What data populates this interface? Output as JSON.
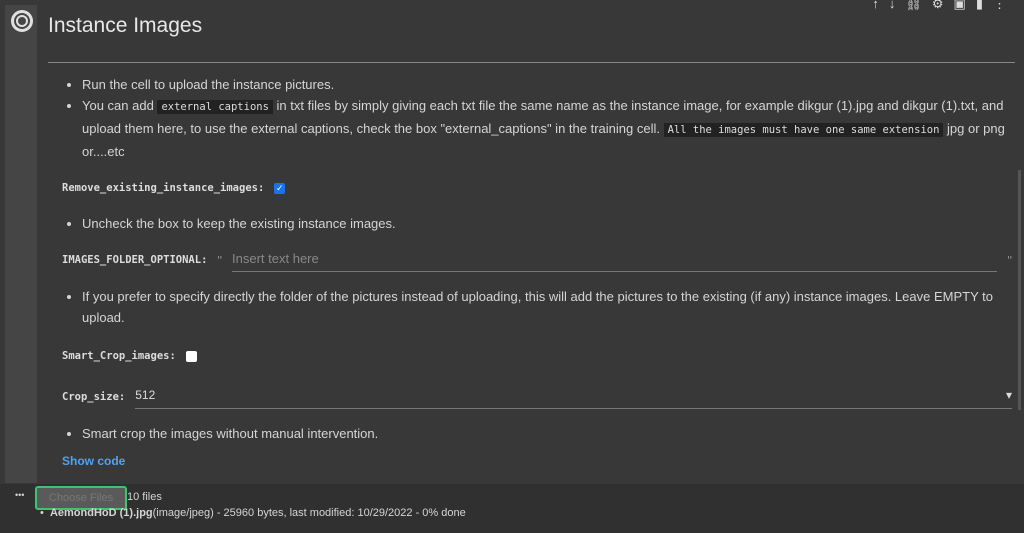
{
  "cell": {
    "title": "Instance Images",
    "toolbar_icons": [
      "arrow-up-icon",
      "arrow-down-icon",
      "link-icon",
      "gear-icon",
      "mirror-icon",
      "delete-icon",
      "more-icon"
    ]
  },
  "bullets1": [
    "Run the cell to upload the instance pictures."
  ],
  "bullet2": {
    "pre": "You can add ",
    "code1": "external captions",
    "mid": " in txt files by simply giving each txt file the same name as the instance image, for example dikgur (1).jpg and dikgur (1).txt, and upload them here, to use the external captions, check the box \"external_captions\" in the training cell. ",
    "code2": "All the images must have one same extension",
    "post": " jpg or png or....etc"
  },
  "remove": {
    "label": "Remove_existing_instance_images:",
    "checked": true,
    "note": "Uncheck the box to keep the existing instance images."
  },
  "folder": {
    "label": "IMAGES_FOLDER_OPTIONAL:",
    "quote": "\"",
    "placeholder": "Insert text here",
    "note": "If you prefer to specify directly the folder of the pictures instead of uploading, this will add the pictures to the existing (if any) instance images. Leave EMPTY to upload."
  },
  "smart": {
    "label": "Smart_Crop_images:",
    "checked": false
  },
  "crop": {
    "label": "Crop_size:",
    "value": "512",
    "note": "Smart crop the images without manual intervention."
  },
  "show_code": "Show code",
  "output": {
    "menu": "•••",
    "choose": "Choose Files",
    "count": "10 files",
    "file_name": "AemondHoD (1).jpg",
    "file_info": "(image/jpeg) - 25960 bytes, last modified: 10/29/2022 - 0% done"
  }
}
